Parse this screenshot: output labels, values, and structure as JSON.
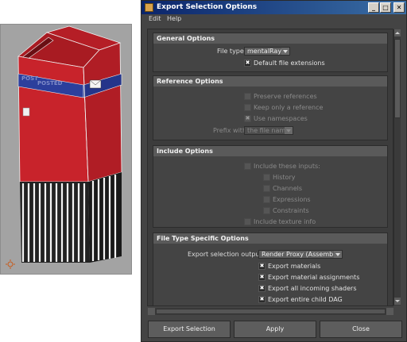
{
  "window": {
    "title": "Export Selection Options",
    "controls": {
      "minimize": "_",
      "maximize": "□",
      "close": "✕"
    }
  },
  "menu": {
    "items": [
      "Edit",
      "Help"
    ]
  },
  "viewport": {
    "model_text_1": "POST",
    "model_text_2": "POSTED"
  },
  "sections": {
    "general": {
      "title": "General Options",
      "file_type_label": "File type:",
      "file_type_value": "mentalRay",
      "default_ext_label": "Default file extensions",
      "default_ext_checked": true
    },
    "reference": {
      "title": "Reference Options",
      "preserve_label": "Preserve references",
      "keep_label": "Keep only a reference",
      "namespaces_label": "Use namespaces",
      "prefix_label": "Prefix with:",
      "prefix_value": "the file name"
    },
    "include": {
      "title": "Include Options",
      "include_inputs_label": "Include these inputs:",
      "history_label": "History",
      "channels_label": "Channels",
      "expressions_label": "Expressions",
      "constraints_label": "Constraints",
      "texture_label": "Include texture info"
    },
    "filetype": {
      "title": "File Type Specific Options",
      "output_label": "Export selection output:",
      "output_value": "Render Proxy (Assembly)",
      "materials_label": "Export materials",
      "assignments_label": "Export material assignments",
      "shaders_label": "Export all incoming shaders",
      "dag_label": "Export entire child DAG"
    }
  },
  "buttons": {
    "export": "Export Selection",
    "apply": "Apply",
    "close": "Close"
  },
  "colors": {
    "mailbox_red": "#c8232b",
    "mailbox_band": "#2c3f9c",
    "titlebar_start": "#0a246a",
    "titlebar_end": "#3a6ea5"
  }
}
